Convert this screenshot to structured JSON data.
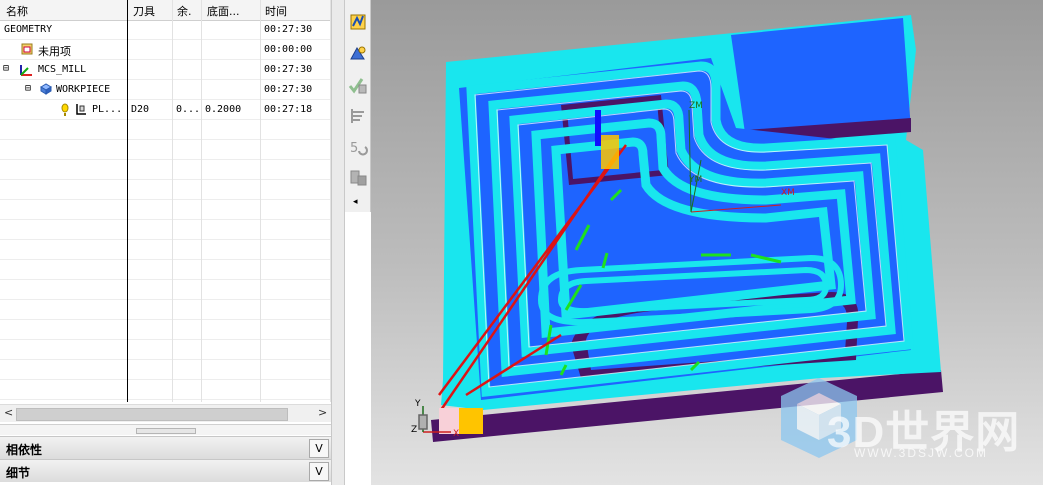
{
  "navigator": {
    "columns": {
      "name": "名称",
      "tool": "刀具",
      "stock": "余.",
      "floor": "底面...",
      "time": "时间"
    },
    "rows": [
      {
        "name": "GEOMETRY",
        "tool": "",
        "stock": "",
        "floor": "",
        "time": "00:27:30"
      },
      {
        "name": "未用项",
        "tool": "",
        "stock": "",
        "floor": "",
        "time": "00:00:00"
      },
      {
        "name": "MCS_MILL",
        "tool": "",
        "stock": "",
        "floor": "",
        "time": "00:27:30"
      },
      {
        "name": "WORKPIECE",
        "tool": "",
        "stock": "",
        "floor": "",
        "time": "00:27:30"
      },
      {
        "name": "PL...",
        "tool": "D20",
        "stock": "0...",
        "floor": "0.2000",
        "time": "00:27:18"
      }
    ],
    "tree_toggles": {
      "mcs": "⊟",
      "workpiece": "⊟"
    }
  },
  "panels": {
    "dependencies": "相依性",
    "details": "细节",
    "chevron": "V"
  },
  "scroll": {
    "left": "<",
    "right": ">"
  },
  "toolbar": {
    "more": "◂"
  },
  "viewport": {
    "axis_labels": {
      "xm": "XM",
      "ym": "YM",
      "zm": "ZM",
      "x": "X",
      "y": "Y",
      "z": "Z"
    }
  },
  "watermark": {
    "text": "3D世界网",
    "url": "WWW.3DSJW.COM"
  },
  "colors": {
    "part_top": "#19e6ee",
    "part_floor": "#1e64ff",
    "part_wall": "#4b1466",
    "toolpath_engage": "#1ee11e",
    "toolpath_rapid": "#dd1414",
    "highlight": "#ffc400"
  }
}
